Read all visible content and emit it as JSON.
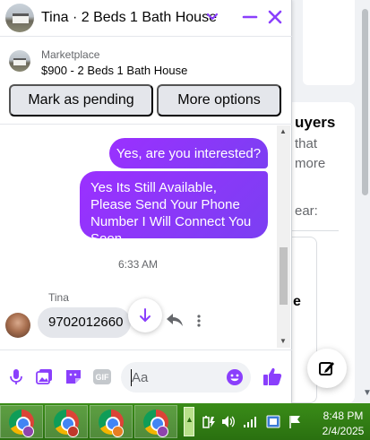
{
  "chat": {
    "title": "Tina · 2 Beds 1 Bath House",
    "marketplace": {
      "label": "Marketplace",
      "listing": "$900 - 2 Beds 1 Bath House",
      "mark_pending_label": "Mark as pending",
      "more_options_label": "More options"
    },
    "messages": [
      {
        "direction": "outgoing",
        "text": "Yes, are you interested?"
      },
      {
        "direction": "outgoing",
        "text": "Yes Its Still Available, Please Send Your Phone Number I Will Connect You Soon"
      },
      {
        "direction": "incoming",
        "sender": "Tina",
        "text": "9702012660"
      }
    ],
    "timestamp": "6:33 AM",
    "composer": {
      "placeholder": "Aa"
    }
  },
  "background_page": {
    "heading_fragment": "uyers",
    "line1": "that",
    "line2": "more",
    "line3": "ear:",
    "line4": "e"
  },
  "taskbar": {
    "time": "8:48 PM",
    "date": "2/4/2025",
    "profile_colors": [
      "#8e44ad",
      "#c0392b",
      "#e67e22",
      "#8e44ad"
    ]
  },
  "colors": {
    "accent": "#8a3ffc",
    "outgoing_bubble": "#8a3ffc",
    "incoming_bubble": "#e4e6eb",
    "taskbar": "#2d7a12"
  }
}
